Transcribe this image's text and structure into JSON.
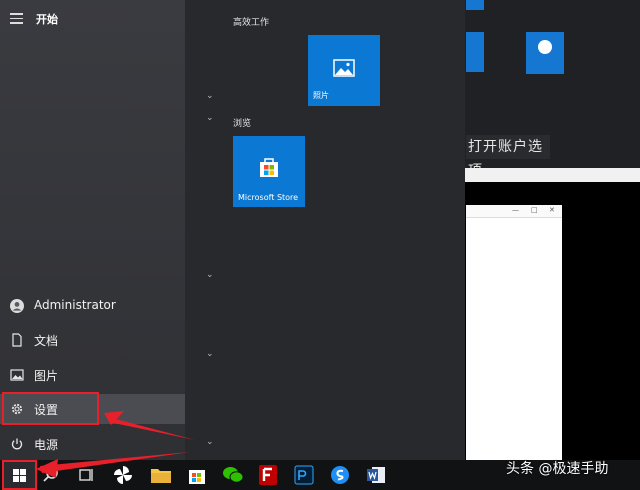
{
  "start_menu": {
    "title": "开始",
    "user": "Administrator",
    "items": [
      {
        "label": "文档"
      },
      {
        "label": "图片"
      },
      {
        "label": "设置"
      },
      {
        "label": "电源"
      }
    ]
  },
  "tile_groups": [
    {
      "label": "高效工作",
      "tiles": [
        {
          "label": "照片"
        }
      ]
    },
    {
      "label": "浏览",
      "tiles": [
        {
          "label": "Microsoft Store"
        }
      ]
    }
  ],
  "background": {
    "option_text": "打开账户选项"
  },
  "watermark": "头条 @极速手助",
  "colors": {
    "accent": "#0b78d4",
    "highlight_border": "#e8202a"
  }
}
